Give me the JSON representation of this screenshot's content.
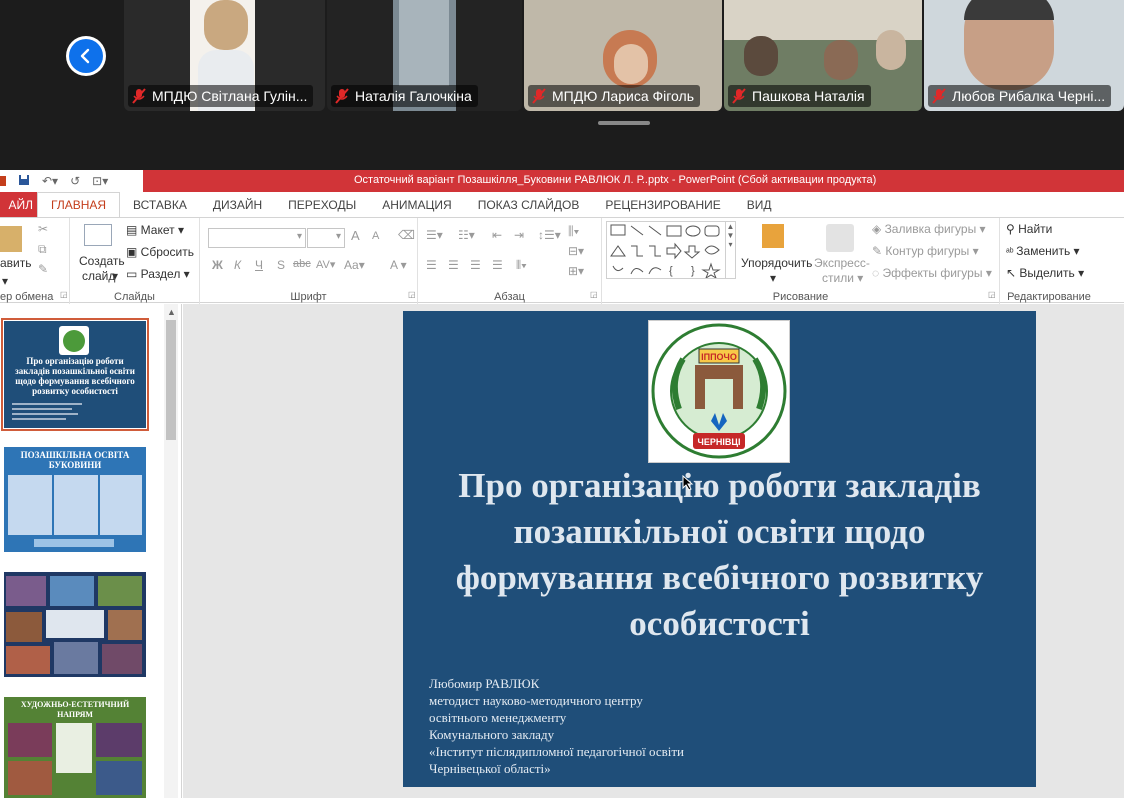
{
  "meeting": {
    "participants": [
      {
        "name": "МПДЮ Світлана Гулін...",
        "muted": true
      },
      {
        "name": "Наталія Галочкіна",
        "muted": true
      },
      {
        "name": "МПДЮ Лариса Фіголь",
        "muted": true
      },
      {
        "name": "Пашкова Наталія",
        "muted": true
      },
      {
        "name": "Любов Рибалка Черні...",
        "muted": true
      }
    ]
  },
  "ppt": {
    "window_title": "Остаточний варіант Позашкілля_Буковини РАВЛЮК Л. Р..pptx -  PowerPoint (Сбой активации продукта)",
    "tabs": [
      "АЙЛ",
      "ГЛАВНАЯ",
      "ВСТАВКА",
      "ДИЗАЙН",
      "ПЕРЕХОДЫ",
      "АНИМАЦИЯ",
      "ПОКАЗ СЛАЙДОВ",
      "РЕЦЕНЗИРОВАНИЕ",
      "ВИД"
    ],
    "active_tab": "ГЛАВНАЯ",
    "ribbon": {
      "clipboard": {
        "paste": "авить",
        "label": "ер обмена"
      },
      "slides": {
        "create_line1": "Создать",
        "create_line2": "слайд",
        "layout": "Макет",
        "reset": "Сбросить",
        "section": "Раздел",
        "label": "Слайды"
      },
      "font": {
        "label": "Шрифт",
        "bold": "Ж",
        "italic": "К",
        "underline": "Ч",
        "shadow": "S",
        "strike": "abc",
        "spacing": "AV",
        "case": "Aa",
        "color": "A",
        "grow": "A",
        "shrink": "A"
      },
      "paragraph": {
        "label": "Абзац"
      },
      "drawing": {
        "arrange": "Упорядочить",
        "styles_line1": "Экспресс-",
        "styles_line2": "стили",
        "fill": "Заливка фигуры",
        "outline": "Контур фигуры",
        "effects": "Эффекты фигуры",
        "label": "Рисование"
      },
      "editing": {
        "find": "Найти",
        "replace": "Заменить",
        "select": "Выделить",
        "label": "Редактирование"
      }
    },
    "thumbnails": [
      {
        "title": "Про організацію роботи закладів позашкільної освіти щодо формування всебічного розвитку особистості",
        "selected": true
      },
      {
        "title": "ПОЗАШКІЛЬНА ОСВІТА БУКОВИНИ",
        "selected": false
      },
      {
        "title": "",
        "selected": false
      },
      {
        "title": "ХУДОЖНЬО-ЕСТЕТИЧНИЙ НАПРЯМ",
        "selected": false
      }
    ],
    "slide": {
      "logo_text_top": "ІППОЧО",
      "logo_text_bottom": "ЧЕРНІВЦІ",
      "title": "Про організацію роботи закладів позашкільної освіти щодо формування всебічного розвитку особистості",
      "author": "Любомир РАВЛЮК\nметодист науково-методичного центру\nосвітнього менеджменту\nКомунального закладу\n«Інститут післядипломної педагогічної освіти\nЧернівецької області»"
    }
  }
}
